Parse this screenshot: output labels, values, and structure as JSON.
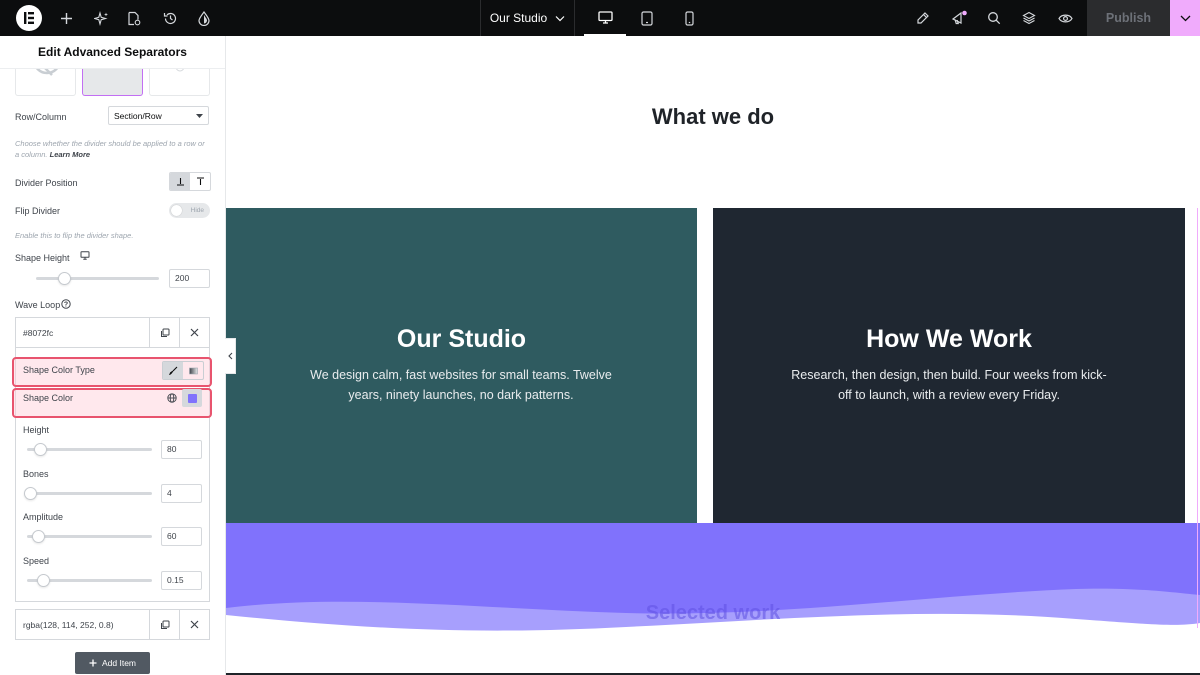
{
  "topbar": {
    "icons": [
      "elementor-logo-icon",
      "add-icon",
      "ai-sparkle-icon",
      "page-settings-icon",
      "history-icon",
      "site-style-icon",
      "devices-icon",
      "notes-icon",
      "whats-new-icon",
      "search-icon",
      "structure-icon",
      "preview-icon"
    ],
    "page_title": "Our Studio",
    "publish_label": "Publish"
  },
  "panel": {
    "title": "Edit Advanced Separators",
    "row_column": {
      "label": "Row/Column",
      "value": "Section/Row",
      "note": "Choose whether the divider should be applied to a row or a column.",
      "note_link": "Learn More"
    },
    "divider_position": {
      "label": "Divider Position"
    },
    "flip_divider": {
      "label": "Flip Divider",
      "toggle_label": "Hide",
      "note": "Enable this to flip the divider shape."
    },
    "shape_height": {
      "label": "Shape Height",
      "value": "200",
      "fraction": 0.2
    },
    "wave_loop": {
      "label": "Wave Loop",
      "items": [
        {
          "title": "#8072fc"
        },
        {
          "title": "rgba(128, 114, 252, 0.8)"
        }
      ],
      "add_label": "Add Item"
    },
    "item_controls": {
      "shape_color_type_label": "Shape Color Type",
      "shape_color_label": "Shape Color",
      "shape_color_value": "#8072fc",
      "sliders": [
        {
          "label": "Height",
          "value": "80",
          "fraction": 0.08
        },
        {
          "label": "Bones",
          "value": "4",
          "fraction": 0.0
        },
        {
          "label": "Amplitude",
          "value": "60",
          "fraction": 0.06
        },
        {
          "label": "Speed",
          "value": "0.15",
          "fraction": 0.1
        }
      ]
    }
  },
  "canvas": {
    "heading": "What we do",
    "cards": [
      {
        "title": "Our Studio",
        "text": "We design calm, fast websites for small teams. Twelve years, ninety launches, no dark patterns.",
        "color": "#2f5b60"
      },
      {
        "title": "How We Work",
        "text": "Research, then design, then build. Four weeks from kick-off to launch, with a review every Friday.",
        "color": "#1f2731"
      }
    ],
    "next_heading": "Selected work",
    "wave_colors": [
      "#8072fc",
      "rgba(128, 114, 252, 0.8)"
    ]
  }
}
